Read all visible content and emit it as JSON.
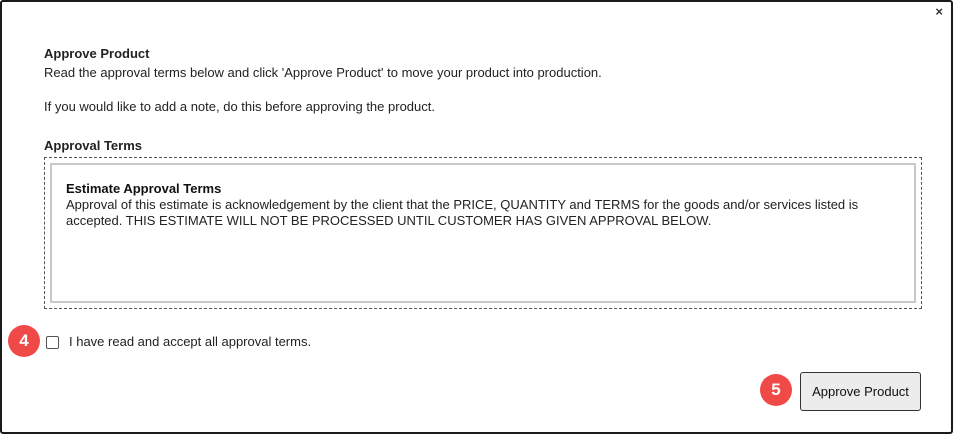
{
  "dialog": {
    "close_glyph": "×",
    "title": "Approve Product",
    "instructions": "Read the approval terms below and click 'Approve Product' to move your product into production.",
    "note_hint": "If you would like to add a note, do this before approving the product.",
    "terms_heading": "Approval Terms",
    "terms_box": {
      "title": "Estimate Approval Terms",
      "body": "Approval of this estimate is acknowledgement by the client that the PRICE, QUANTITY and TERMS for the goods and/or services listed is accepted. THIS ESTIMATE WILL NOT BE PROCESSED UNTIL CUSTOMER HAS GIVEN APPROVAL BELOW."
    },
    "accept_checkbox": {
      "label": "I have read and accept all approval terms.",
      "checked": false
    },
    "approve_button_label": "Approve Product"
  },
  "annotations": {
    "step_checkbox": "4",
    "step_button": "5",
    "marker_color": "#ef4a48"
  }
}
